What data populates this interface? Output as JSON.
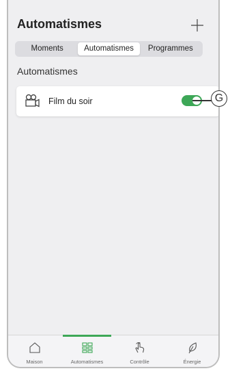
{
  "header": {
    "title": "Automatismes",
    "add_icon": "plus-icon"
  },
  "tabs": [
    {
      "label": "Moments",
      "active": false
    },
    {
      "label": "Automatismes",
      "active": true
    },
    {
      "label": "Programmes",
      "active": false
    }
  ],
  "section": {
    "title": "Automatismes"
  },
  "automations": [
    {
      "icon": "movie-camera-icon",
      "name": "Film du soir",
      "enabled": true
    }
  ],
  "callout": {
    "letter": "G"
  },
  "navbar": [
    {
      "label": "Maison",
      "icon": "home-icon",
      "active": false
    },
    {
      "label": "Automatismes",
      "icon": "grid-icon",
      "active": true
    },
    {
      "label": "Contrôle",
      "icon": "hand-icon",
      "active": false
    },
    {
      "label": "Énergie",
      "icon": "leaf-icon",
      "active": false
    }
  ],
  "colors": {
    "accent": "#3da757",
    "background": "#efeff1"
  }
}
